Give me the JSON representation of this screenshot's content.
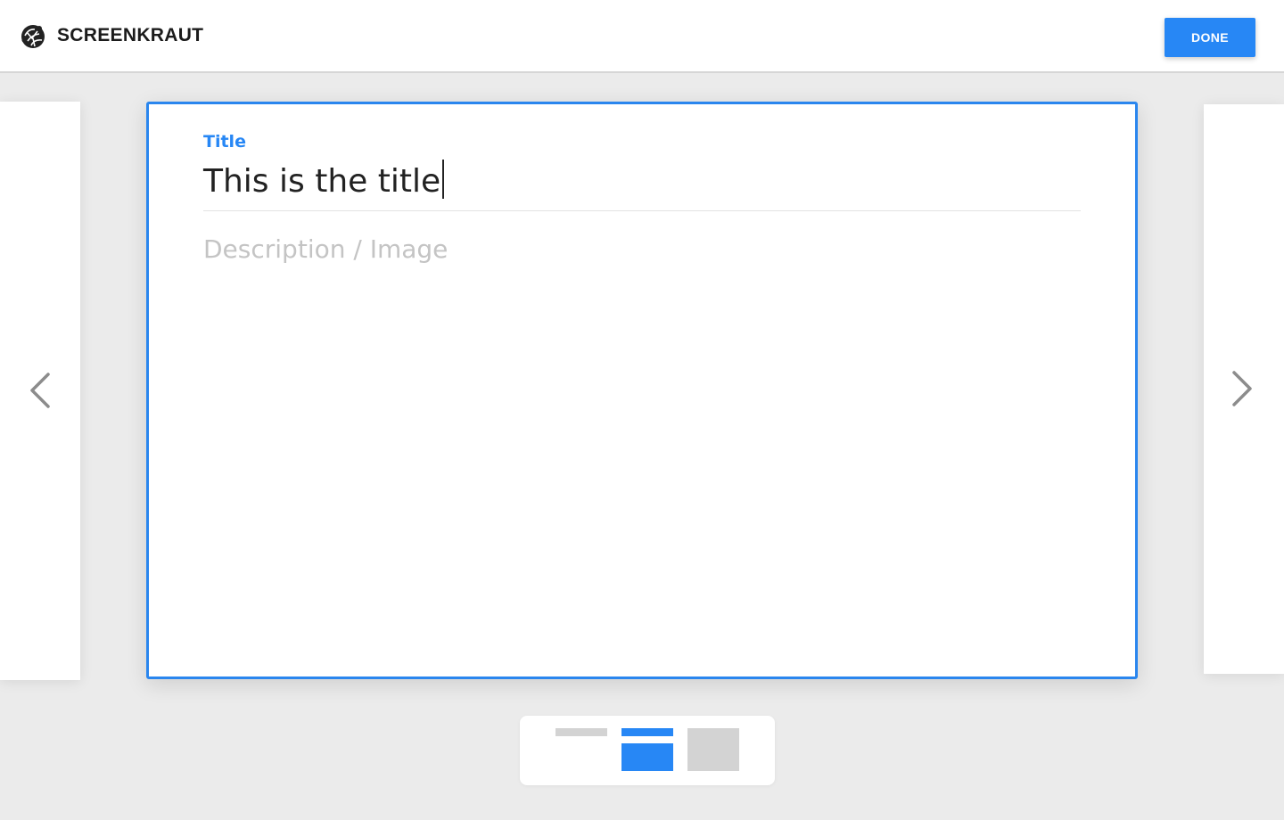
{
  "header": {
    "app_name": "SCREENKRAUT",
    "logo_icon": "screenkraut-logo-icon",
    "done_label": "DONE"
  },
  "colors": {
    "accent": "#2787f5",
    "background": "#ebebeb",
    "card": "#ffffff",
    "placeholder": "#c4c4c4",
    "inactive_layout": "#d3d3d3"
  },
  "navigation": {
    "prev_icon": "chevron-left-icon",
    "next_icon": "chevron-right-icon"
  },
  "card": {
    "title_label": "Title",
    "title_value": "This is the title",
    "description_placeholder": "Description / Image"
  },
  "layout_switcher": {
    "options": [
      {
        "icon": "title-only-layout-icon",
        "selected": false
      },
      {
        "icon": "title-and-content-layout-icon",
        "selected": true
      },
      {
        "icon": "image-only-layout-icon",
        "selected": false
      }
    ]
  }
}
